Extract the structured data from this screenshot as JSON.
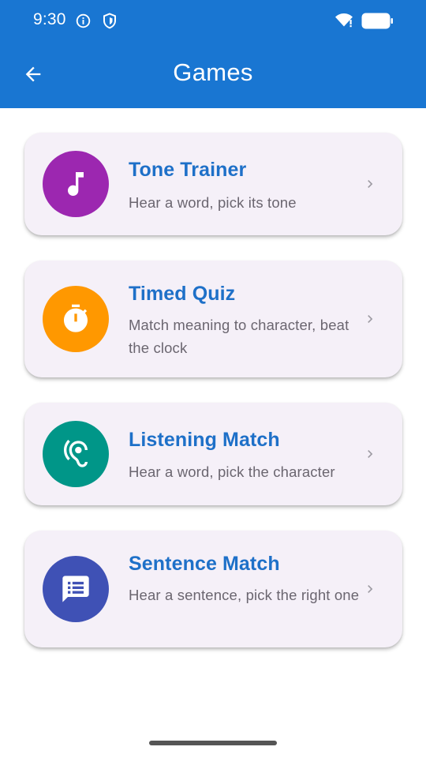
{
  "status_bar": {
    "time": "9:30",
    "icons": [
      "info-icon",
      "shield-icon",
      "wifi-icon",
      "battery-icon"
    ]
  },
  "app_bar": {
    "title": "Games",
    "back_icon": "arrow-back-icon"
  },
  "colors": {
    "primary": "#1976d2",
    "card_background": "#f5f0f8",
    "title_text": "#1e70c8",
    "subtitle_text": "#6b6670"
  },
  "games": [
    {
      "title": "Tone Trainer",
      "subtitle": "Hear a word, pick its tone",
      "icon": "music-note-icon",
      "color": "#9c27b0"
    },
    {
      "title": "Timed Quiz",
      "subtitle": "Match meaning to character, beat the clock",
      "icon": "timer-icon",
      "color": "#ff9800"
    },
    {
      "title": "Listening Match",
      "subtitle": "Hear a word, pick the character",
      "icon": "hearing-icon",
      "color": "#009688"
    },
    {
      "title": "Sentence Match",
      "subtitle": "Hear a sentence, pick the right one",
      "icon": "message-icon",
      "color": "#3f51b5"
    }
  ]
}
